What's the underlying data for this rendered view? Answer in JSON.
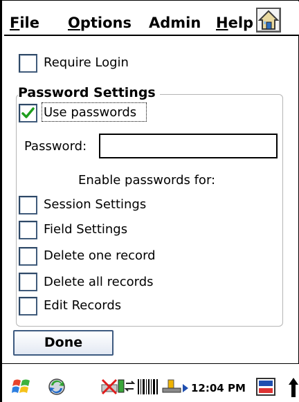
{
  "menu": {
    "file_first": "F",
    "file_rest": "ile",
    "options_first": "O",
    "options_rest": "ptions",
    "admin": "Admin",
    "help_first": "H",
    "help_rest": "elp",
    "home_icon": "home-icon"
  },
  "require_login": {
    "label": "Require Login",
    "checked": false
  },
  "password_settings": {
    "title": "Password Settings",
    "use_passwords": {
      "label": "Use passwords",
      "checked": true
    },
    "password_label": "Password:",
    "password_value": "",
    "enable_for_label": "Enable passwords for:",
    "options": [
      {
        "label": "Session Settings",
        "checked": false
      },
      {
        "label": "Field Settings",
        "checked": false
      },
      {
        "label": "Delete one record",
        "checked": false
      },
      {
        "label": "Delete all records",
        "checked": false
      },
      {
        "label": "Edit Records",
        "checked": false
      }
    ]
  },
  "done_button": "Done",
  "taskbar": {
    "clock": "12:04 PM",
    "icons": [
      "start-flag-icon",
      "sync-icon",
      "network-icon",
      "connection-icon",
      "barcode-icon",
      "usb-icon",
      "play-arrow-icon",
      "keyboard-icon",
      "input-panel-icon",
      "arrow-up-icon"
    ]
  },
  "colors": {
    "checkbox_border": "#3f5a7a",
    "checkmark": "#1e9e1e",
    "button_border": "#3d5a80"
  }
}
